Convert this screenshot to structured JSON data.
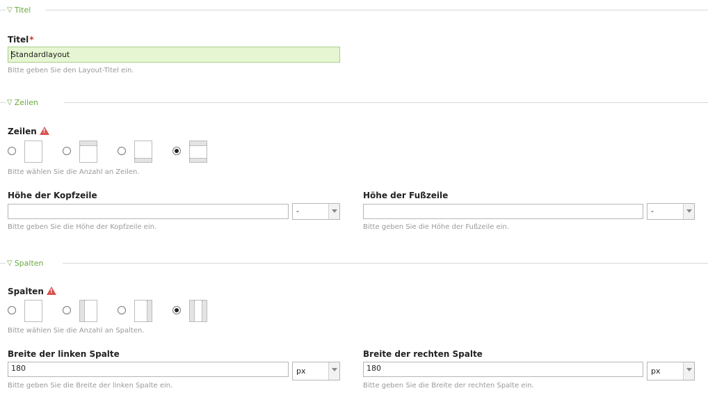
{
  "sections": {
    "titel": {
      "legend": "Titel"
    },
    "zeilen": {
      "legend": "Zeilen"
    },
    "spalten": {
      "legend": "Spalten"
    }
  },
  "title_field": {
    "label": "Titel",
    "required_mark": "*",
    "value": "Standardlayout",
    "hint": "Bitte geben Sie den Layout-Titel ein."
  },
  "rows": {
    "label": "Zeilen",
    "hint": "Bitte wählen Sie die Anzahl an Zeilen.",
    "selected_option": 4
  },
  "header_height": {
    "label": "Höhe der Kopfzeile",
    "value": "",
    "unit": "-",
    "hint": "Bitte geben Sie die Höhe der Kopfzeile ein."
  },
  "footer_height": {
    "label": "Höhe der Fußzeile",
    "value": "",
    "unit": "-",
    "hint": "Bitte geben Sie die Höhe der Fußzeile ein."
  },
  "columns": {
    "label": "Spalten",
    "hint": "Bitte wählen Sie die Anzahl an Spalten.",
    "selected_option": 4
  },
  "left_width": {
    "label": "Breite der linken Spalte",
    "value": "180",
    "unit": "px",
    "hint": "Bitte geben Sie die Breite der linken Spalte ein."
  },
  "right_width": {
    "label": "Breite der rechten Spalte",
    "value": "180",
    "unit": "px",
    "hint": "Bitte geben Sie die Breite der rechten Spalte ein."
  },
  "colors": {
    "legend": "#6aa73a",
    "title_bg": "#e6f6d3",
    "warning": "#d9534f"
  }
}
